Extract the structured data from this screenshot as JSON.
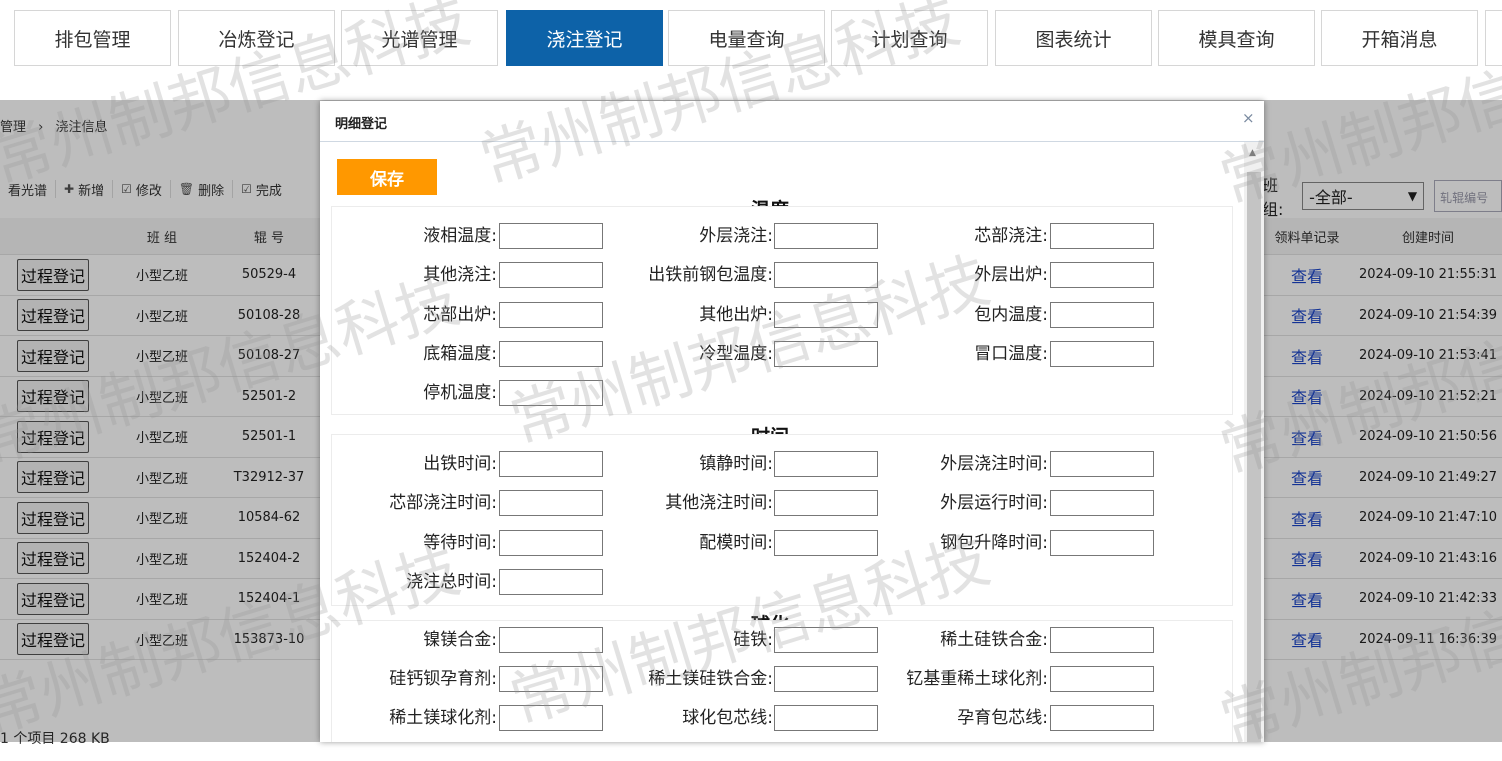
{
  "nav": {
    "items": [
      {
        "label": "排包管理",
        "active": false
      },
      {
        "label": "冶炼登记",
        "active": false
      },
      {
        "label": "光谱管理",
        "active": false
      },
      {
        "label": "浇注登记",
        "active": true
      },
      {
        "label": "电量查询",
        "active": false
      },
      {
        "label": "计划查询",
        "active": false
      },
      {
        "label": "图表统计",
        "active": false
      },
      {
        "label": "模具查询",
        "active": false
      },
      {
        "label": "开箱消息",
        "active": false
      }
    ]
  },
  "breadcrumb": {
    "parent": "管理",
    "sep": "›",
    "current": "浇注信息"
  },
  "toolbar": {
    "items": [
      {
        "label": "看光谱",
        "icon": ""
      },
      {
        "label": "新增",
        "icon": "plus-icon"
      },
      {
        "label": "修改",
        "icon": "edit-icon"
      },
      {
        "label": "删除",
        "icon": "trash-icon"
      },
      {
        "label": "完成",
        "icon": "check-icon"
      }
    ]
  },
  "filter": {
    "label": "班组:",
    "selected": "-全部-",
    "input_placeholder": "轧辊编号"
  },
  "table": {
    "headers": {
      "group": "班 组",
      "roll": "辊 号",
      "record": "领料单记录",
      "created": "创建时间"
    },
    "row_button": "过程登记",
    "view_label": "查看",
    "rows": [
      {
        "group": "小型乙班",
        "roll": "50529-4",
        "created": "2024-09-10 21:55:31"
      },
      {
        "group": "小型乙班",
        "roll": "50108-28",
        "created": "2024-09-10 21:54:39"
      },
      {
        "group": "小型乙班",
        "roll": "50108-27",
        "created": "2024-09-10 21:53:41"
      },
      {
        "group": "小型乙班",
        "roll": "52501-2",
        "created": "2024-09-10 21:52:21"
      },
      {
        "group": "小型乙班",
        "roll": "52501-1",
        "created": "2024-09-10 21:50:56"
      },
      {
        "group": "小型乙班",
        "roll": "T32912-37",
        "created": "2024-09-10 21:49:27"
      },
      {
        "group": "小型乙班",
        "roll": "10584-62",
        "created": "2024-09-10 21:47:10"
      },
      {
        "group": "小型乙班",
        "roll": "152404-2",
        "created": "2024-09-10 21:43:16"
      },
      {
        "group": "小型乙班",
        "roll": "152404-1",
        "created": "2024-09-10 21:42:33"
      },
      {
        "group": "小型乙班",
        "roll": "153873-10",
        "created": "2024-09-11 16:36:39"
      }
    ]
  },
  "status": "1 个项目  268 KB",
  "dialog": {
    "title": "明细登记",
    "close": "×",
    "save_label": "保存",
    "sections": [
      {
        "title": "温度",
        "fields": [
          "液相温度:",
          "外层浇注:",
          "芯部浇注:",
          "其他浇注:",
          "出铁前钢包温度:",
          "外层出炉:",
          "芯部出炉:",
          "其他出炉:",
          "包内温度:",
          "底箱温度:",
          "冷型温度:",
          "冒口温度:",
          "停机温度:"
        ]
      },
      {
        "title": "时间",
        "fields": [
          "出铁时间:",
          "镇静时间:",
          "外层浇注时间:",
          "芯部浇注时间:",
          "其他浇注时间:",
          "外层运行时间:",
          "等待时间:",
          "配模时间:",
          "钢包升降时间:",
          "浇注总时间:"
        ]
      },
      {
        "title": "球化",
        "fields": [
          "镍镁合金:",
          "硅铁:",
          "稀土硅铁合金:",
          "硅钙钡孕育剂:",
          "稀土镁硅铁合金:",
          "钇基重稀土球化剂:",
          "稀土镁球化剂:",
          "球化包芯线:",
          "孕育包芯线:"
        ]
      }
    ]
  },
  "watermark": "常州制邦信息科技"
}
